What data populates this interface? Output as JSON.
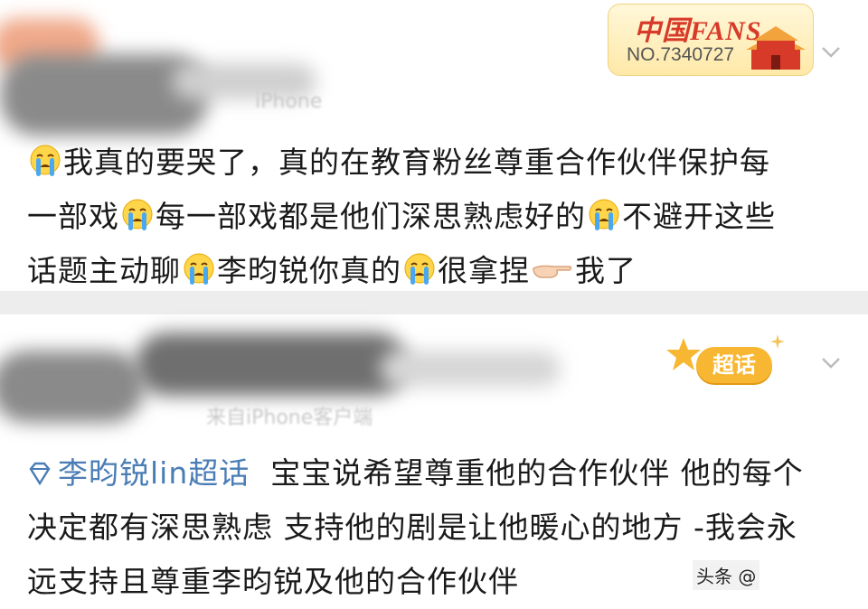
{
  "post1": {
    "badge": {
      "title": "中国FANS",
      "number": "NO.7340727"
    },
    "meta_faint": "iPhone",
    "lines": [
      [
        "我真的要哭了，真的在教育粉丝尊重合作伙伴保护每"
      ],
      [
        "一部戏",
        "每一部戏都是他们深思熟虑好的",
        "不避开这些"
      ],
      [
        "话题主动聊",
        "李昀锐你真的",
        "很拿捏",
        "我了"
      ]
    ],
    "icons": [
      "crying-emoji",
      "pointing-hand-emoji",
      "chevron-down-icon",
      "fan-badge-gate-icon"
    ]
  },
  "post2": {
    "badge_label": "超话",
    "meta_faint": "来自iPhone客户端",
    "topic_link": "李昀锐lin超话",
    "lines": [
      "宝宝说希望尊重他的合作伙伴 他的每个",
      "决定都有深思熟虑 支持他的剧是让他暖心的地方 -我会永",
      "远支持且尊重李昀锐及他的合作伙伴"
    ],
    "watermark": "头条 @"
  },
  "colors": {
    "link": "#4a7db5",
    "badge_gold": "#f7b733",
    "fan_red": "#d83a2a",
    "divider": "#ededed"
  }
}
